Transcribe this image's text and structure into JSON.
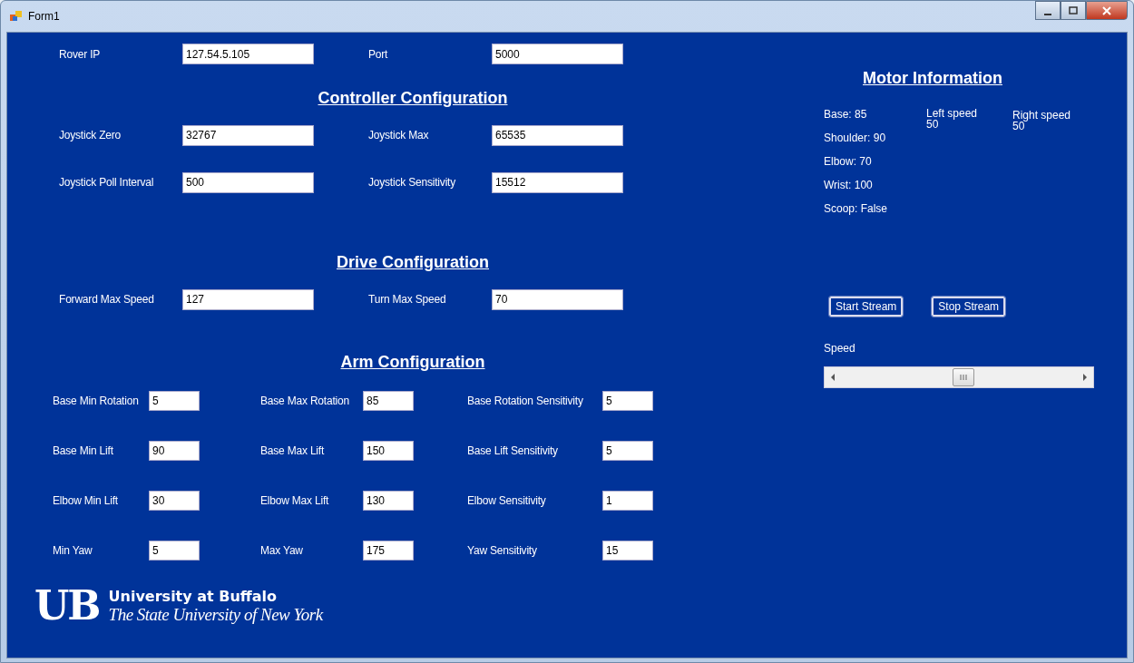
{
  "window": {
    "title": "Form1"
  },
  "connection": [
    {
      "label": "Rover IP",
      "value": "127.54.5.105"
    },
    {
      "label": "Port",
      "value": "5000"
    }
  ],
  "sections": [
    {
      "title": "Controller Configuration",
      "rows": [
        [
          {
            "label": "Joystick Zero",
            "value": "32767"
          },
          {
            "label": "Joystick Max",
            "value": "65535"
          }
        ],
        [
          {
            "label": "Joystick Poll Interval",
            "value": "500"
          },
          {
            "label": "Joystick Sensitivity",
            "value": "15512"
          }
        ]
      ]
    },
    {
      "title": "Drive Configuration",
      "rows": [
        [
          {
            "label": "Forward Max Speed",
            "value": "127"
          },
          {
            "label": "Turn Max Speed",
            "value": "70"
          }
        ]
      ]
    }
  ],
  "arm": {
    "title": "Arm Configuration",
    "rows": [
      [
        {
          "label": "Base Min Rotation",
          "value": "5"
        },
        {
          "label": "Base Max Rotation",
          "value": "85"
        },
        {
          "label": "Base Rotation Sensitivity",
          "value": "5"
        }
      ],
      [
        {
          "label": "Base Min Lift",
          "value": "90"
        },
        {
          "label": "Base Max Lift",
          "value": "150"
        },
        {
          "label": "Base Lift Sensitivity",
          "value": "5"
        }
      ],
      [
        {
          "label": "Elbow Min Lift",
          "value": "30"
        },
        {
          "label": "Elbow Max Lift",
          "value": "130"
        },
        {
          "label": "Elbow Sensitivity",
          "value": "1"
        }
      ],
      [
        {
          "label": "Min Yaw",
          "value": "5"
        },
        {
          "label": "Max Yaw",
          "value": "175"
        },
        {
          "label": "Yaw Sensitivity",
          "value": "15"
        }
      ]
    ]
  },
  "logo": {
    "mark": "UB",
    "name": "University at Buffalo",
    "subtitle": "The State University of New York"
  },
  "motor": {
    "title": "Motor Information",
    "readings": [
      "Base: 85",
      "Shoulder: 90",
      "Elbow: 70",
      "Wrist: 100",
      "Scoop: False"
    ],
    "speeds": [
      {
        "label": "Left speed",
        "value": "50"
      },
      {
        "label": "Right speed",
        "value": "50"
      }
    ]
  },
  "buttons": [
    "Start Stream",
    "Stop Stream"
  ],
  "speed": {
    "label": "Speed"
  }
}
